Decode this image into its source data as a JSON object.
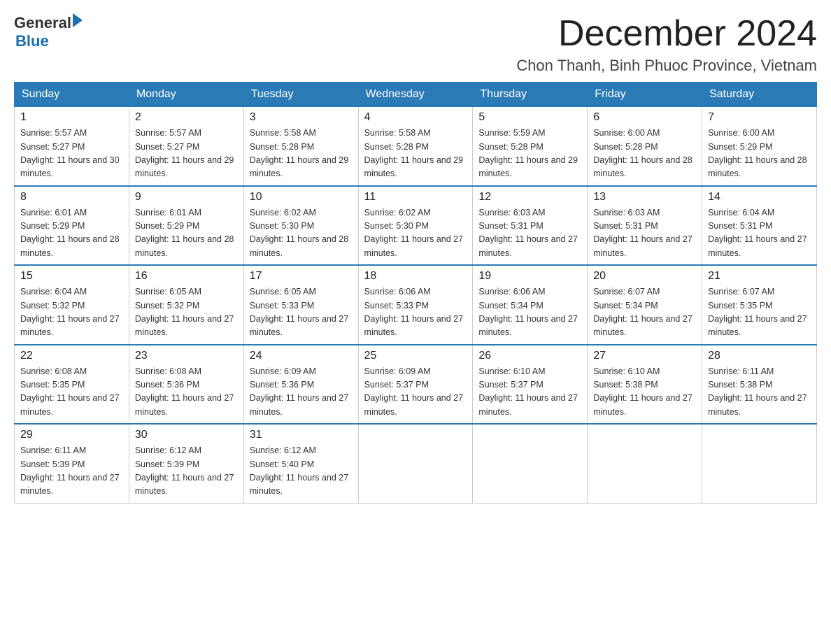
{
  "header": {
    "logo_general": "General",
    "logo_blue": "Blue",
    "month_title": "December 2024",
    "location": "Chon Thanh, Binh Phuoc Province, Vietnam"
  },
  "weekdays": [
    "Sunday",
    "Monday",
    "Tuesday",
    "Wednesday",
    "Thursday",
    "Friday",
    "Saturday"
  ],
  "weeks": [
    [
      {
        "day": "1",
        "sunrise": "5:57 AM",
        "sunset": "5:27 PM",
        "daylight": "11 hours and 30 minutes."
      },
      {
        "day": "2",
        "sunrise": "5:57 AM",
        "sunset": "5:27 PM",
        "daylight": "11 hours and 29 minutes."
      },
      {
        "day": "3",
        "sunrise": "5:58 AM",
        "sunset": "5:28 PM",
        "daylight": "11 hours and 29 minutes."
      },
      {
        "day": "4",
        "sunrise": "5:58 AM",
        "sunset": "5:28 PM",
        "daylight": "11 hours and 29 minutes."
      },
      {
        "day": "5",
        "sunrise": "5:59 AM",
        "sunset": "5:28 PM",
        "daylight": "11 hours and 29 minutes."
      },
      {
        "day": "6",
        "sunrise": "6:00 AM",
        "sunset": "5:28 PM",
        "daylight": "11 hours and 28 minutes."
      },
      {
        "day": "7",
        "sunrise": "6:00 AM",
        "sunset": "5:29 PM",
        "daylight": "11 hours and 28 minutes."
      }
    ],
    [
      {
        "day": "8",
        "sunrise": "6:01 AM",
        "sunset": "5:29 PM",
        "daylight": "11 hours and 28 minutes."
      },
      {
        "day": "9",
        "sunrise": "6:01 AM",
        "sunset": "5:29 PM",
        "daylight": "11 hours and 28 minutes."
      },
      {
        "day": "10",
        "sunrise": "6:02 AM",
        "sunset": "5:30 PM",
        "daylight": "11 hours and 28 minutes."
      },
      {
        "day": "11",
        "sunrise": "6:02 AM",
        "sunset": "5:30 PM",
        "daylight": "11 hours and 27 minutes."
      },
      {
        "day": "12",
        "sunrise": "6:03 AM",
        "sunset": "5:31 PM",
        "daylight": "11 hours and 27 minutes."
      },
      {
        "day": "13",
        "sunrise": "6:03 AM",
        "sunset": "5:31 PM",
        "daylight": "11 hours and 27 minutes."
      },
      {
        "day": "14",
        "sunrise": "6:04 AM",
        "sunset": "5:31 PM",
        "daylight": "11 hours and 27 minutes."
      }
    ],
    [
      {
        "day": "15",
        "sunrise": "6:04 AM",
        "sunset": "5:32 PM",
        "daylight": "11 hours and 27 minutes."
      },
      {
        "day": "16",
        "sunrise": "6:05 AM",
        "sunset": "5:32 PM",
        "daylight": "11 hours and 27 minutes."
      },
      {
        "day": "17",
        "sunrise": "6:05 AM",
        "sunset": "5:33 PM",
        "daylight": "11 hours and 27 minutes."
      },
      {
        "day": "18",
        "sunrise": "6:06 AM",
        "sunset": "5:33 PM",
        "daylight": "11 hours and 27 minutes."
      },
      {
        "day": "19",
        "sunrise": "6:06 AM",
        "sunset": "5:34 PM",
        "daylight": "11 hours and 27 minutes."
      },
      {
        "day": "20",
        "sunrise": "6:07 AM",
        "sunset": "5:34 PM",
        "daylight": "11 hours and 27 minutes."
      },
      {
        "day": "21",
        "sunrise": "6:07 AM",
        "sunset": "5:35 PM",
        "daylight": "11 hours and 27 minutes."
      }
    ],
    [
      {
        "day": "22",
        "sunrise": "6:08 AM",
        "sunset": "5:35 PM",
        "daylight": "11 hours and 27 minutes."
      },
      {
        "day": "23",
        "sunrise": "6:08 AM",
        "sunset": "5:36 PM",
        "daylight": "11 hours and 27 minutes."
      },
      {
        "day": "24",
        "sunrise": "6:09 AM",
        "sunset": "5:36 PM",
        "daylight": "11 hours and 27 minutes."
      },
      {
        "day": "25",
        "sunrise": "6:09 AM",
        "sunset": "5:37 PM",
        "daylight": "11 hours and 27 minutes."
      },
      {
        "day": "26",
        "sunrise": "6:10 AM",
        "sunset": "5:37 PM",
        "daylight": "11 hours and 27 minutes."
      },
      {
        "day": "27",
        "sunrise": "6:10 AM",
        "sunset": "5:38 PM",
        "daylight": "11 hours and 27 minutes."
      },
      {
        "day": "28",
        "sunrise": "6:11 AM",
        "sunset": "5:38 PM",
        "daylight": "11 hours and 27 minutes."
      }
    ],
    [
      {
        "day": "29",
        "sunrise": "6:11 AM",
        "sunset": "5:39 PM",
        "daylight": "11 hours and 27 minutes."
      },
      {
        "day": "30",
        "sunrise": "6:12 AM",
        "sunset": "5:39 PM",
        "daylight": "11 hours and 27 minutes."
      },
      {
        "day": "31",
        "sunrise": "6:12 AM",
        "sunset": "5:40 PM",
        "daylight": "11 hours and 27 minutes."
      },
      null,
      null,
      null,
      null
    ]
  ]
}
